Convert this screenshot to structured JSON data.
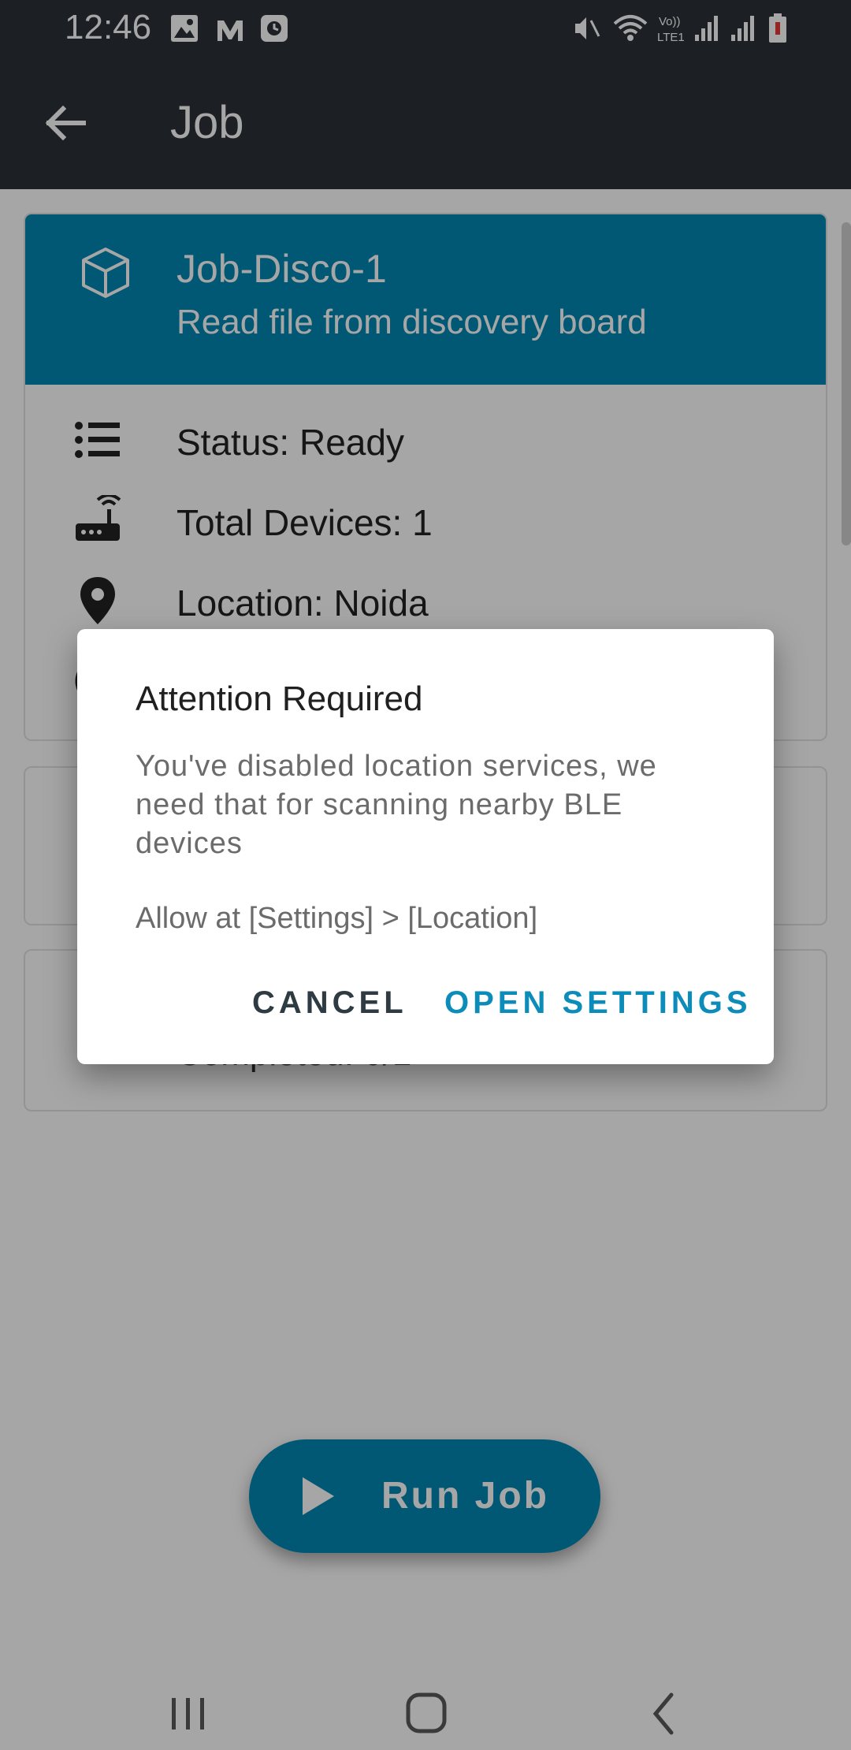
{
  "status_bar": {
    "time": "12:46",
    "left_icons": [
      "image-icon",
      "news-icon",
      "clock-app-icon"
    ],
    "right_icons": [
      "mute-icon",
      "wifi-icon",
      "volte-icon",
      "signal-icon",
      "signal-icon",
      "battery-low-icon"
    ],
    "volte_label": "Vo))\nLTE1"
  },
  "app_bar": {
    "title": "Job",
    "back_icon": "arrow-left-icon"
  },
  "job_card": {
    "name": "Job-Disco-1",
    "description": "Read file from discovery board",
    "icon": "cube-icon",
    "rows": [
      {
        "icon": "list-icon",
        "text": "Status: Ready"
      },
      {
        "icon": "router-icon",
        "text": "Total Devices: 1"
      },
      {
        "icon": "location-pin-icon",
        "text": "Location: Noida"
      }
    ]
  },
  "progress_card": {
    "text": "Completed: 0/1"
  },
  "run_button": {
    "label": "Run Job",
    "icon": "play-icon"
  },
  "dialog": {
    "title": "Attention Required",
    "message": "You've disabled location services, we\nneed that for scanning nearby BLE\ndevices",
    "hint": "Allow at [Settings] > [Location]",
    "cancel_label": "CANCEL",
    "confirm_label": "OPEN SETTINGS"
  },
  "nav_bar": {
    "icons": [
      "recents-icon",
      "home-icon",
      "back-nav-icon"
    ]
  },
  "colors": {
    "app_bar": "#2b3137",
    "accent": "#0287b4",
    "dialog_button": "#0c8cb8"
  }
}
